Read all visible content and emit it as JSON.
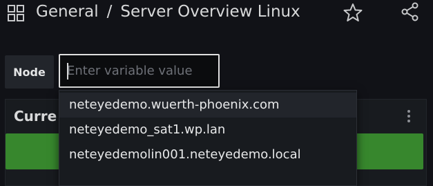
{
  "header": {
    "folder": "General",
    "separator": "/",
    "dashboard_title": "Server Overview Linux"
  },
  "variable": {
    "label": "Node",
    "placeholder": "Enter variable value",
    "value": ""
  },
  "panel": {
    "title": "Curre",
    "stat_color": "#37872d"
  },
  "dropdown": {
    "options": [
      "neteyedemo.wuerth-phoenix.com",
      "neteyedemo_sat1.wp.lan",
      "neteyedemolin001.neteyedemo.local"
    ],
    "highlighted_index": 0
  },
  "icons": {
    "apps": "grid-icon",
    "favorite": "star-icon",
    "share": "share-icon",
    "panel_menu": "kebab-menu-icon"
  }
}
